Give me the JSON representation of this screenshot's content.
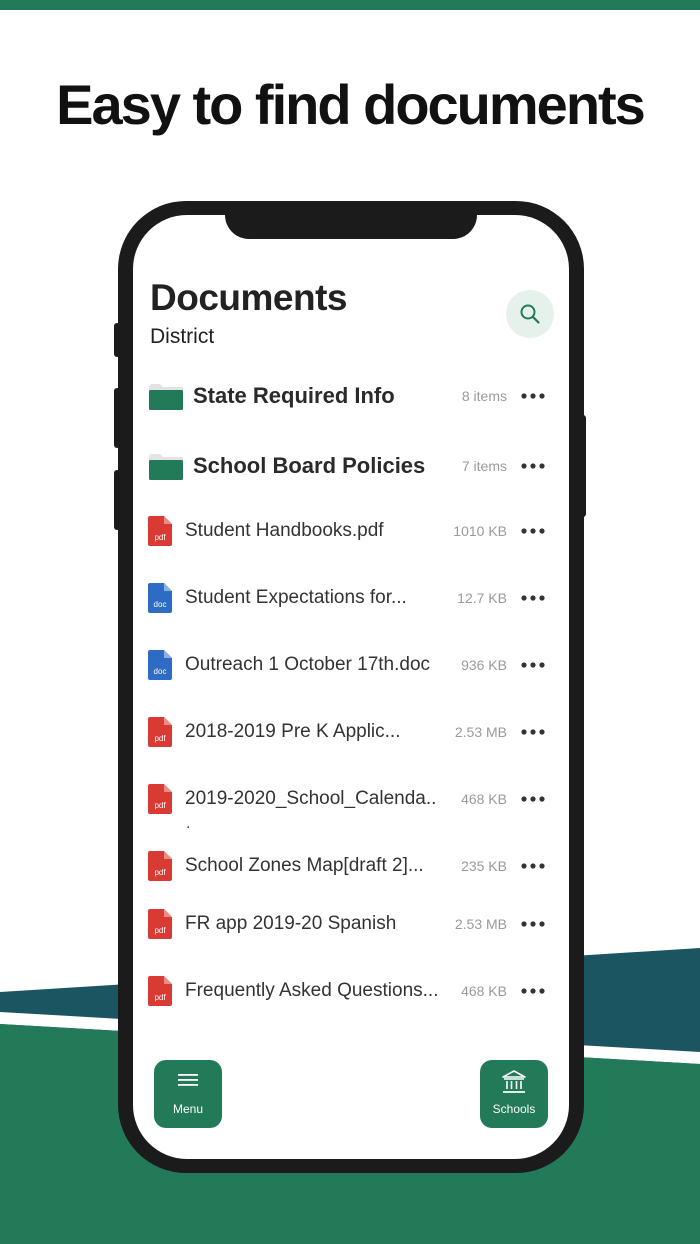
{
  "headline": "Easy to find documents",
  "header": {
    "title": "Documents",
    "subtitle": "District",
    "search_icon": "search-icon"
  },
  "items": [
    {
      "kind": "folder",
      "name": "State Required Info",
      "meta": "8 items"
    },
    {
      "kind": "folder",
      "name": "School Board Policies",
      "meta": "7 items"
    },
    {
      "kind": "pdf",
      "name": "Student Handbooks.pdf",
      "meta": "1010 KB"
    },
    {
      "kind": "doc",
      "name": "Student Expectations for...",
      "meta": "12.7 KB"
    },
    {
      "kind": "doc",
      "name": "Outreach 1 October 17th.doc",
      "meta": "936 KB"
    },
    {
      "kind": "pdf",
      "name": "2018-2019 Pre K Applic...",
      "meta": "2.53 MB"
    },
    {
      "kind": "pdf",
      "name": "2019-2020_School_Calenda..",
      "meta": "468 KB"
    },
    {
      "kind": "pdf",
      "name": "School Zones Map[draft 2]...",
      "meta": "235 KB"
    },
    {
      "kind": "pdf",
      "name": "FR app 2019-20 Spanish",
      "meta": "2.53 MB"
    },
    {
      "kind": "pdf",
      "name": "Frequently Asked Questions...",
      "meta": "468 KB"
    }
  ],
  "file_badges": {
    "pdf": "pdf",
    "doc": "doc"
  },
  "wrap_fragment": ".",
  "tabbar": {
    "menu_label": "Menu",
    "schools_label": "Schools"
  },
  "colors": {
    "brand_green": "#237a59",
    "teal": "#1c5562",
    "pdf_red": "#d93a34",
    "doc_blue": "#2e6bc4"
  }
}
